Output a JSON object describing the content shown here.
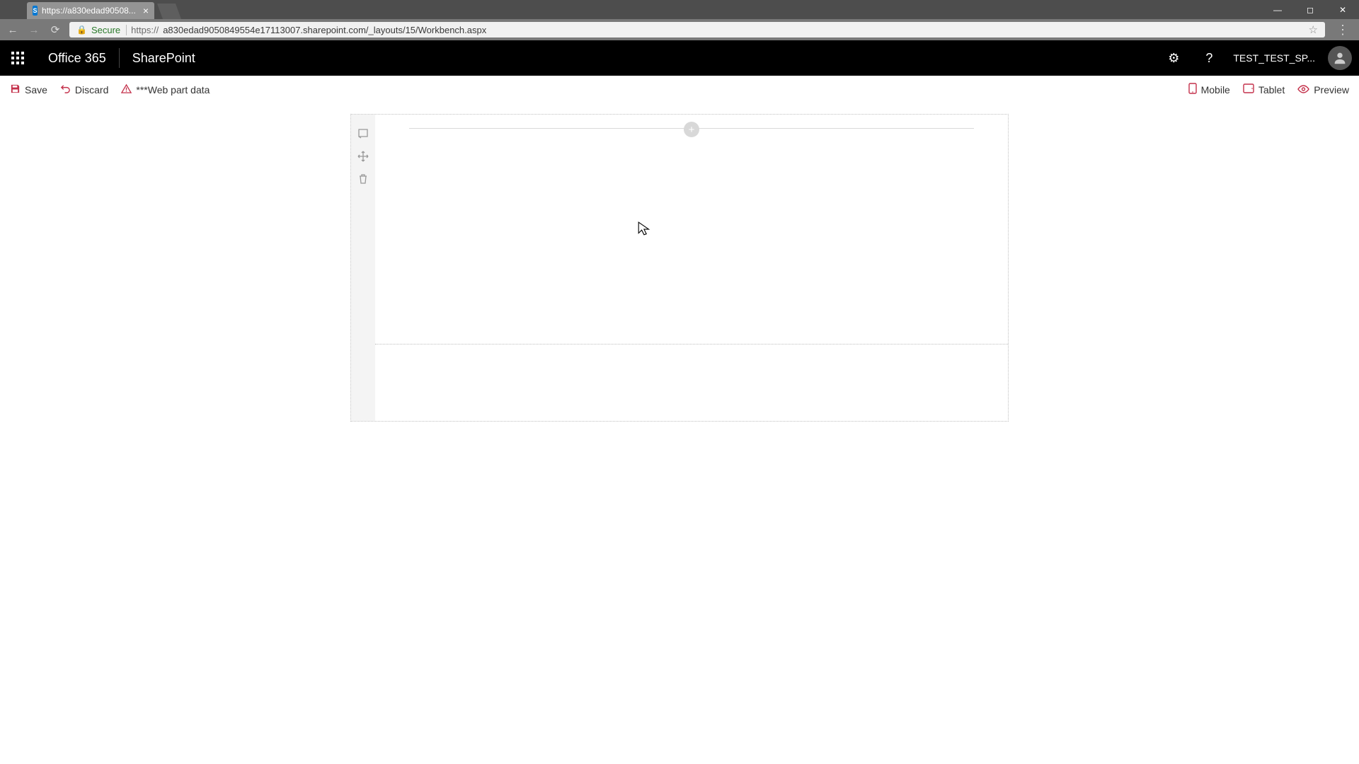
{
  "browser": {
    "tab_title": "https://a830edad90508...",
    "secure_label": "Secure",
    "url_prefix": "https://",
    "url_main": "a830edad9050849554e17113007.sharepoint.com/_layouts/15/Workbench.aspx"
  },
  "suite": {
    "brand": "Office 365",
    "app": "SharePoint",
    "user": "TEST_TEST_SP..."
  },
  "commands": {
    "save": "Save",
    "discard": "Discard",
    "webpart_data": "***Web part data",
    "mobile": "Mobile",
    "tablet": "Tablet",
    "preview": "Preview"
  }
}
